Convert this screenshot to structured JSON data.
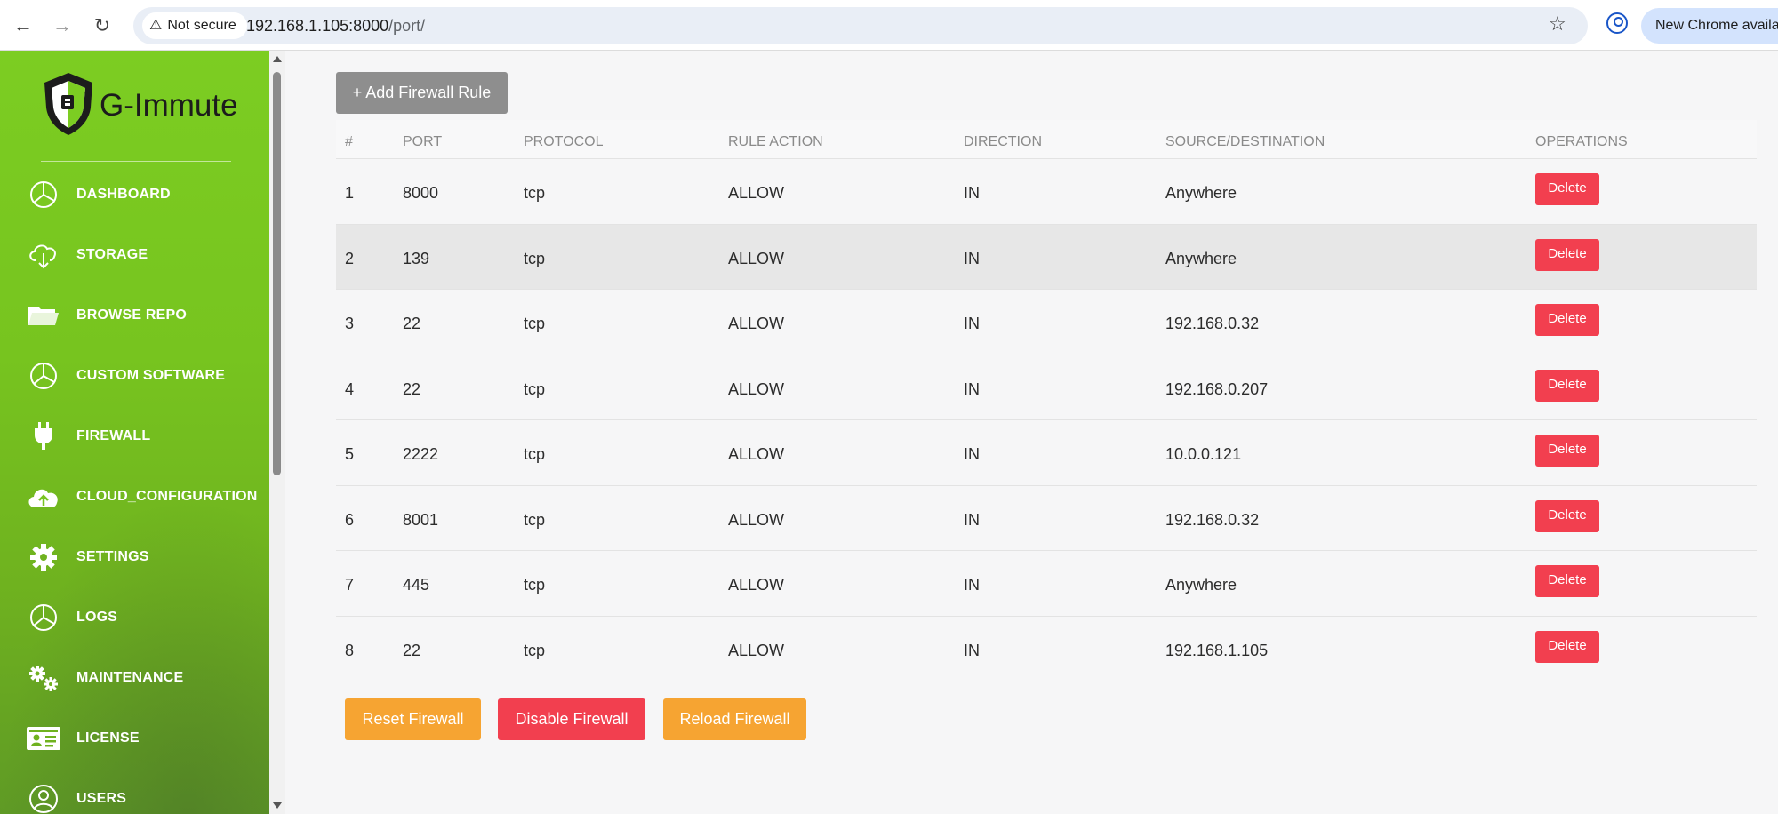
{
  "browser": {
    "security_label": "Not secure",
    "url_host": "192.168.1.105:8000",
    "url_path": "/port/",
    "update_label": "New Chrome available"
  },
  "sidebar": {
    "brand": "G-Immute",
    "items": [
      {
        "label": "DASHBOARD",
        "icon": "pie-chart-icon"
      },
      {
        "label": "STORAGE",
        "icon": "cloud-download-icon"
      },
      {
        "label": "BROWSE REPO",
        "icon": "folder-icon"
      },
      {
        "label": "CUSTOM SOFTWARE",
        "icon": "pie-chart-icon"
      },
      {
        "label": "FIREWALL",
        "icon": "plug-icon"
      },
      {
        "label": "CLOUD_CONFIGURATION",
        "icon": "cloud-upload-icon"
      },
      {
        "label": "SETTINGS",
        "icon": "gear-icon"
      },
      {
        "label": "LOGS",
        "icon": "pie-chart-icon"
      },
      {
        "label": "MAINTENANCE",
        "icon": "gears-icon"
      },
      {
        "label": "LICENSE",
        "icon": "id-card-icon"
      },
      {
        "label": "USERS",
        "icon": "user-icon"
      }
    ]
  },
  "main": {
    "add_rule_label": "+ Add Firewall Rule",
    "columns": [
      "#",
      "PORT",
      "PROTOCOL",
      "RULE ACTION",
      "DIRECTION",
      "SOURCE/DESTINATION",
      "OPERATIONS"
    ],
    "rows": [
      [
        "1",
        "8000",
        "tcp",
        "ALLOW",
        "IN",
        "Anywhere"
      ],
      [
        "2",
        "139",
        "tcp",
        "ALLOW",
        "IN",
        "Anywhere"
      ],
      [
        "3",
        "22",
        "tcp",
        "ALLOW",
        "IN",
        "192.168.0.32"
      ],
      [
        "4",
        "22",
        "tcp",
        "ALLOW",
        "IN",
        "192.168.0.207"
      ],
      [
        "5",
        "2222",
        "tcp",
        "ALLOW",
        "IN",
        "10.0.0.121"
      ],
      [
        "6",
        "8001",
        "tcp",
        "ALLOW",
        "IN",
        "192.168.0.32"
      ],
      [
        "7",
        "445",
        "tcp",
        "ALLOW",
        "IN",
        "Anywhere"
      ],
      [
        "8",
        "22",
        "tcp",
        "ALLOW",
        "IN",
        "192.168.1.105"
      ]
    ],
    "delete_label": "Delete",
    "reset_label": "Reset Firewall",
    "disable_label": "Disable Firewall",
    "reload_label": "Reload Firewall"
  },
  "colors": {
    "sidebar_green": "#7ccd22",
    "delete_red": "#f23f4f",
    "action_orange": "#f6a432",
    "add_gray": "#8e8e8e"
  }
}
